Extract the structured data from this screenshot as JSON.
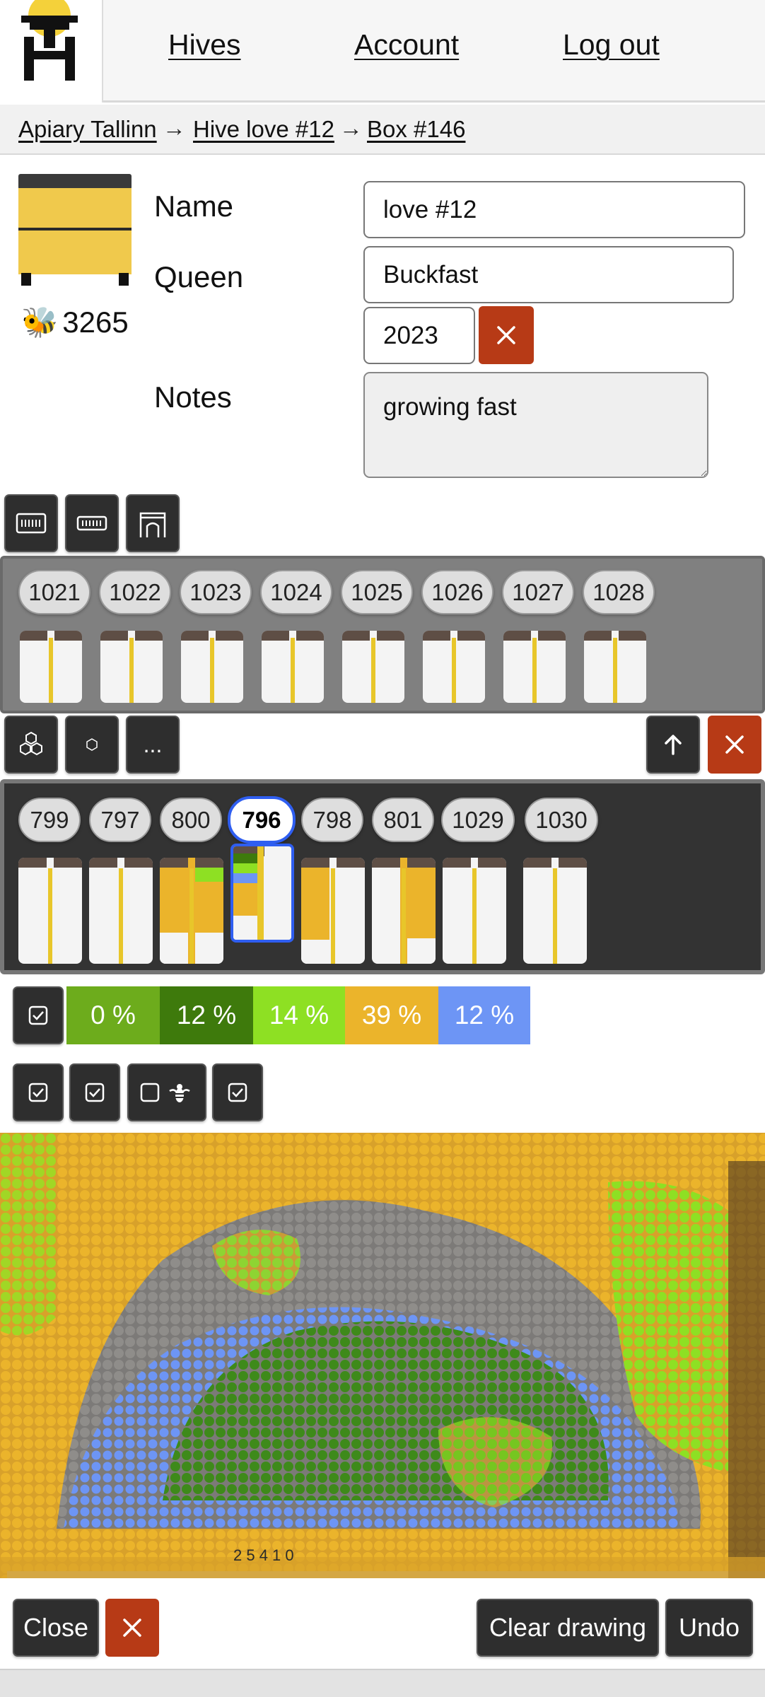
{
  "nav": {
    "hives": "Hives",
    "account": "Account",
    "logout": "Log out"
  },
  "breadcrumb": {
    "apiary": "Apiary Tallinn",
    "hive": "Hive love #12",
    "box": "Box #146",
    "separator": "→"
  },
  "info": {
    "bee_count": "3265",
    "bee_glyph": "🐝",
    "name_label": "Name",
    "queen_label": "Queen",
    "notes_label": "Notes",
    "name_value": "love #12",
    "queen_value": "Buckfast",
    "queen_year": "2023",
    "notes_value": "growing fast"
  },
  "upper_boxes": [
    "1021",
    "1022",
    "1023",
    "1024",
    "1025",
    "1026",
    "1027",
    "1028"
  ],
  "lower_boxes": [
    {
      "label": "799",
      "active": false
    },
    {
      "label": "797",
      "active": false
    },
    {
      "label": "800",
      "active": false
    },
    {
      "label": "796",
      "active": true
    },
    {
      "label": "798",
      "active": false
    },
    {
      "label": "801",
      "active": false
    },
    {
      "label": "1029",
      "active": false
    },
    {
      "label": "1030",
      "active": false
    }
  ],
  "more_label": "...",
  "stats": [
    {
      "label": "0 %",
      "color": "#6dac1c"
    },
    {
      "label": "12 %",
      "color": "#3e7a0c"
    },
    {
      "label": "14 %",
      "color": "#8ee023"
    },
    {
      "label": "39 %",
      "color": "#ebb42b"
    },
    {
      "label": "12 %",
      "color": "#6d95f5"
    }
  ],
  "frame_label": "2 5 4 1 0",
  "bottom": {
    "close": "Close",
    "clear": "Clear drawing",
    "undo": "Undo"
  },
  "colors": {
    "accent_blue": "#2f5ef0",
    "danger_red": "#b73a16",
    "honey_yellow": "#ebb42b",
    "dark_button": "#2e2e2e"
  }
}
